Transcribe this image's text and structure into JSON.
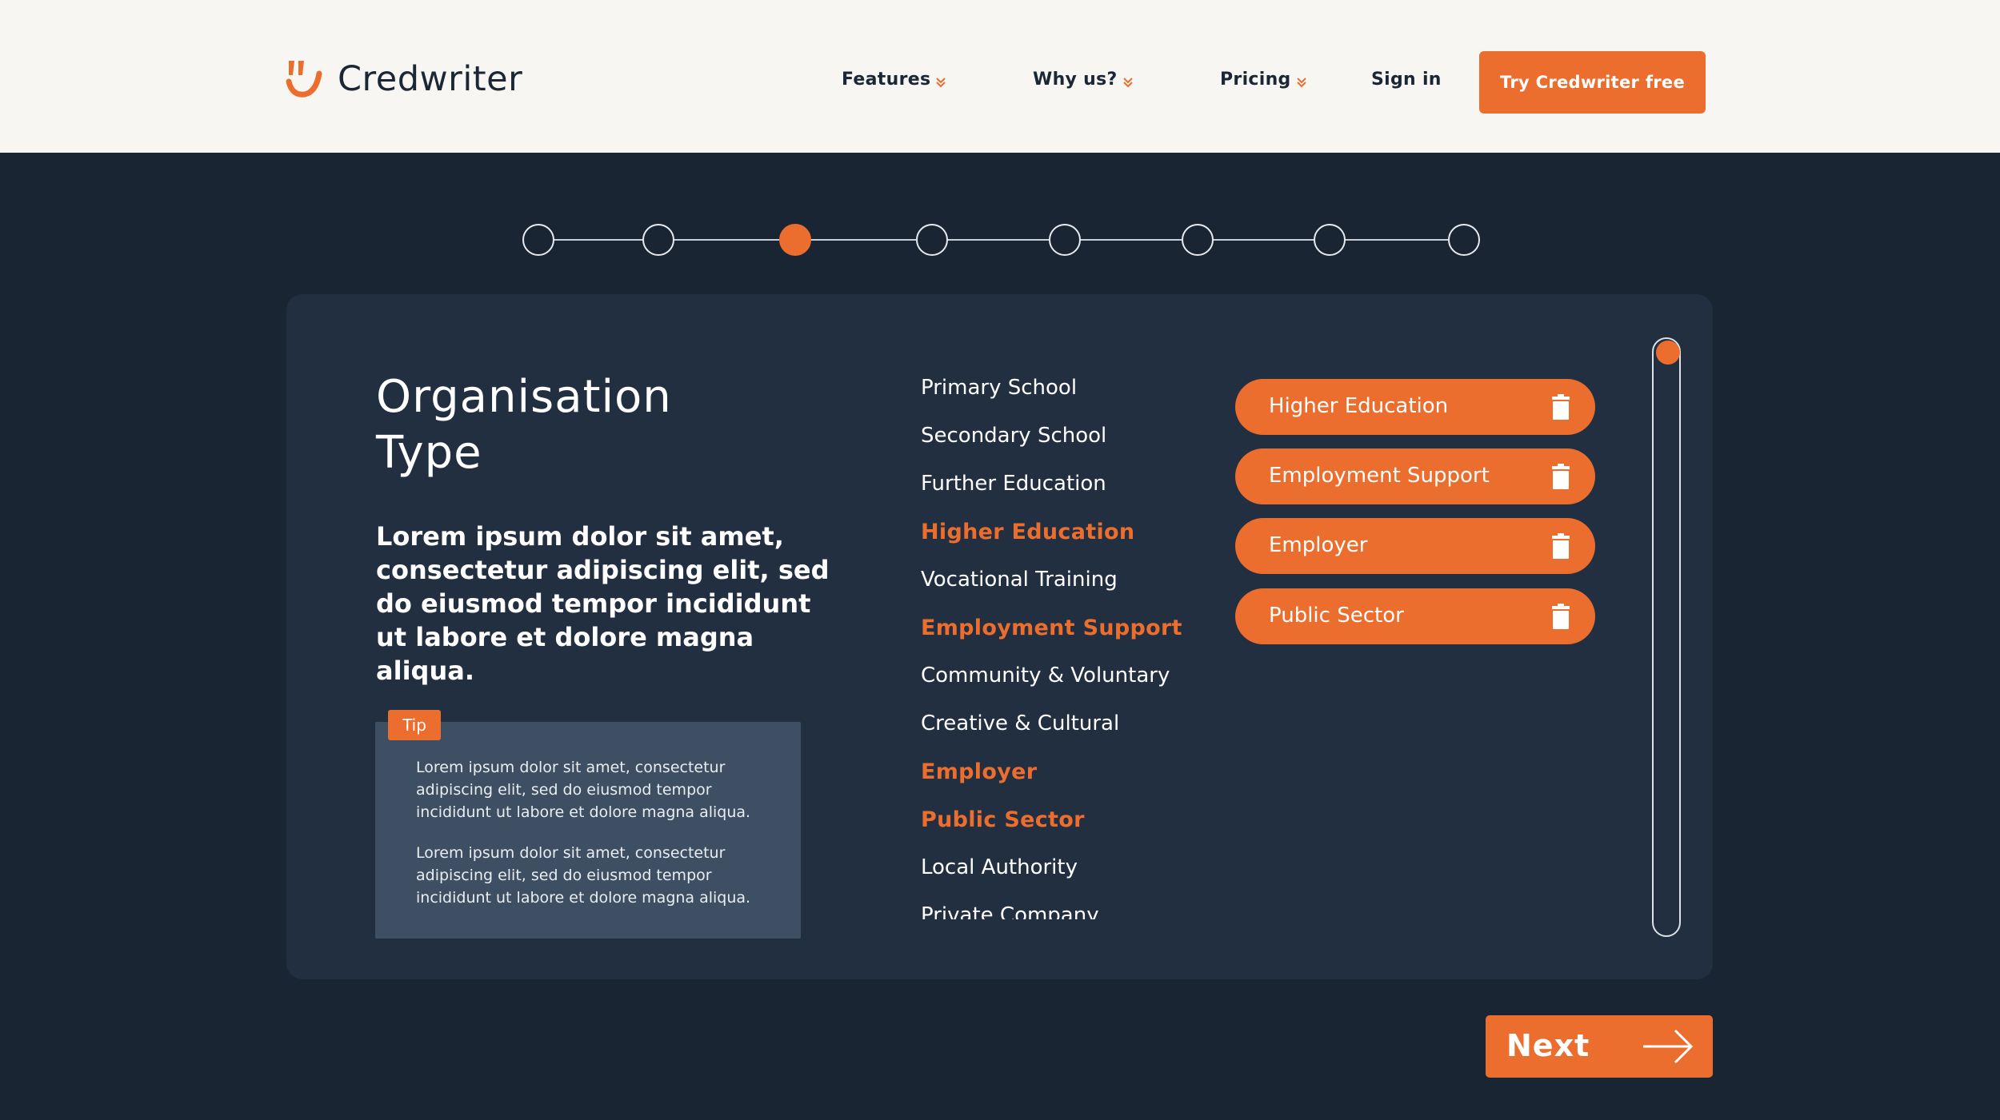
{
  "brand": {
    "name": "Credwriter",
    "logo_icon": "quote-mark-icon",
    "accent": "#ec6e2e",
    "dark_bg": "#1a2533",
    "card_bg": "#222f40"
  },
  "nav": {
    "items": [
      {
        "label": "Features",
        "has_dropdown": true
      },
      {
        "label": "Why us?",
        "has_dropdown": true
      },
      {
        "label": "Pricing",
        "has_dropdown": true
      },
      {
        "label": "Sign in",
        "has_dropdown": false
      }
    ],
    "cta": "Try Credwriter free"
  },
  "stepper": {
    "total_steps": 8,
    "current_step": 3
  },
  "step": {
    "title_line1": "Organisation",
    "title_line2": "Type",
    "lead": "Lorem ipsum dolor sit amet, consectetur adipiscing elit, sed do eiusmod tempor incididunt ut labore et dolore magna aliqua."
  },
  "tip": {
    "badge": "Tip",
    "paragraphs": [
      "Lorem ipsum dolor sit amet, consectetur adipiscing elit, sed do eiusmod tempor incididunt ut labore et dolore magna aliqua.",
      "Lorem ipsum dolor sit amet, consectetur adipiscing elit, sed do eiusmod tempor incididunt ut labore et dolore magna aliqua."
    ]
  },
  "options": [
    {
      "label": "Primary School",
      "selected": false
    },
    {
      "label": "Secondary School",
      "selected": false
    },
    {
      "label": "Further Education",
      "selected": false
    },
    {
      "label": "Higher Education",
      "selected": true
    },
    {
      "label": "Vocational Training",
      "selected": false
    },
    {
      "label": "Employment Support",
      "selected": true
    },
    {
      "label": "Community & Voluntary",
      "selected": false
    },
    {
      "label": "Creative & Cultural",
      "selected": false
    },
    {
      "label": "Employer",
      "selected": true
    },
    {
      "label": "Public Sector",
      "selected": true
    },
    {
      "label": "Local Authority",
      "selected": false
    },
    {
      "label": "Private Company",
      "selected": false
    }
  ],
  "selected_pills": [
    {
      "label": "Higher Education",
      "icon": "trash-icon"
    },
    {
      "label": "Employment Support",
      "icon": "trash-icon"
    },
    {
      "label": "Employer",
      "icon": "trash-icon"
    },
    {
      "label": "Public Sector",
      "icon": "trash-icon"
    }
  ],
  "next_button": {
    "label": "Next",
    "icon": "arrow-right-icon"
  }
}
